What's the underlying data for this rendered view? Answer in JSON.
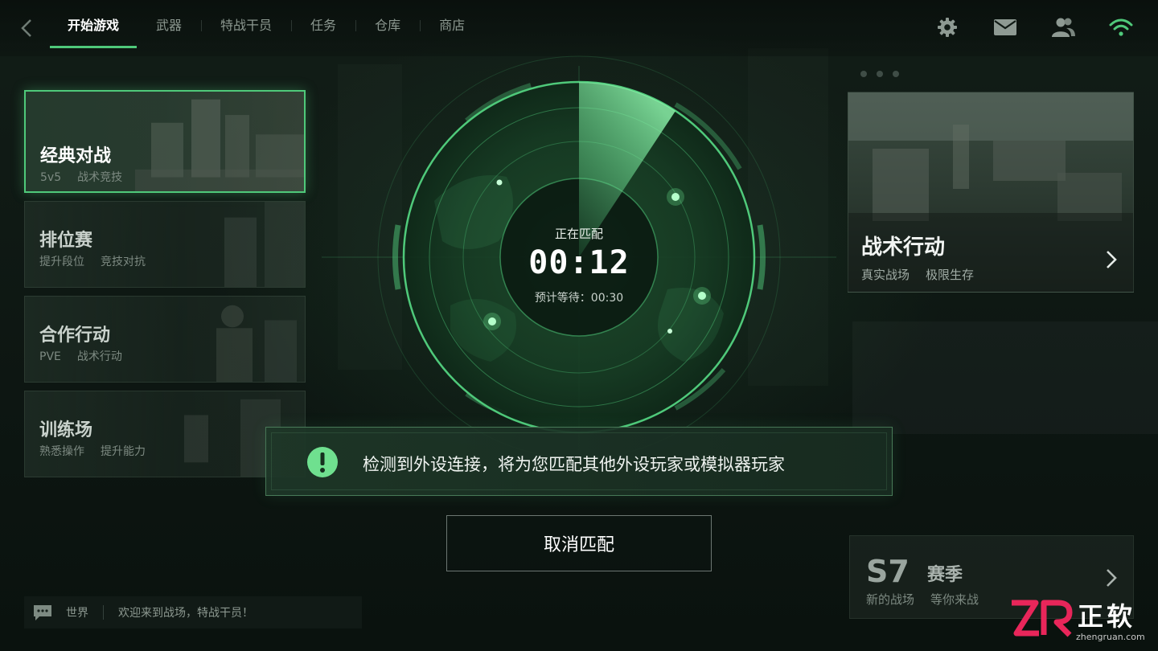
{
  "nav": {
    "tabs": [
      {
        "label": "开始游戏",
        "active": true
      },
      {
        "label": "武器",
        "active": false
      },
      {
        "label": "特战干员",
        "active": false
      },
      {
        "label": "任务",
        "active": false
      },
      {
        "label": "仓库",
        "active": false
      },
      {
        "label": "商店",
        "active": false
      }
    ],
    "icons": [
      "settings-gear-icon",
      "mail-icon",
      "friends-icon",
      "wifi-signal-icon"
    ]
  },
  "modes": [
    {
      "title": "经典对战",
      "tags": [
        "5v5",
        "战术竞技"
      ],
      "selected": true
    },
    {
      "title": "排位赛",
      "tags": [
        "提升段位",
        "竞技对抗"
      ],
      "selected": false
    },
    {
      "title": "合作行动",
      "tags": [
        "PVE",
        "战术行动"
      ],
      "selected": false
    },
    {
      "title": "训练场",
      "tags": [
        "熟悉操作",
        "提升能力"
      ],
      "selected": false
    }
  ],
  "matchmaking": {
    "status": "正在匹配",
    "timer": "00:12",
    "eta": "预计等待：00:30"
  },
  "notice": {
    "icon": "exclamation-circle-icon",
    "text": "检测到外设连接，将为您匹配其他外设玩家或模拟器玩家"
  },
  "cancel_button": "取消匹配",
  "feature": {
    "title": "战术行动",
    "tags": [
      "真实战场",
      "极限生存"
    ]
  },
  "season": {
    "code": "S7",
    "word": "赛季",
    "tags": [
      "新的战场",
      "等你来战"
    ]
  },
  "chat": {
    "channel": "世界",
    "message": "欢迎来到战场，特战干员！"
  },
  "watermark": {
    "brand_cn": "正软",
    "url": "zhengruan.com"
  },
  "colors": {
    "accent": "#4fc97a",
    "background": "#0d1612"
  }
}
